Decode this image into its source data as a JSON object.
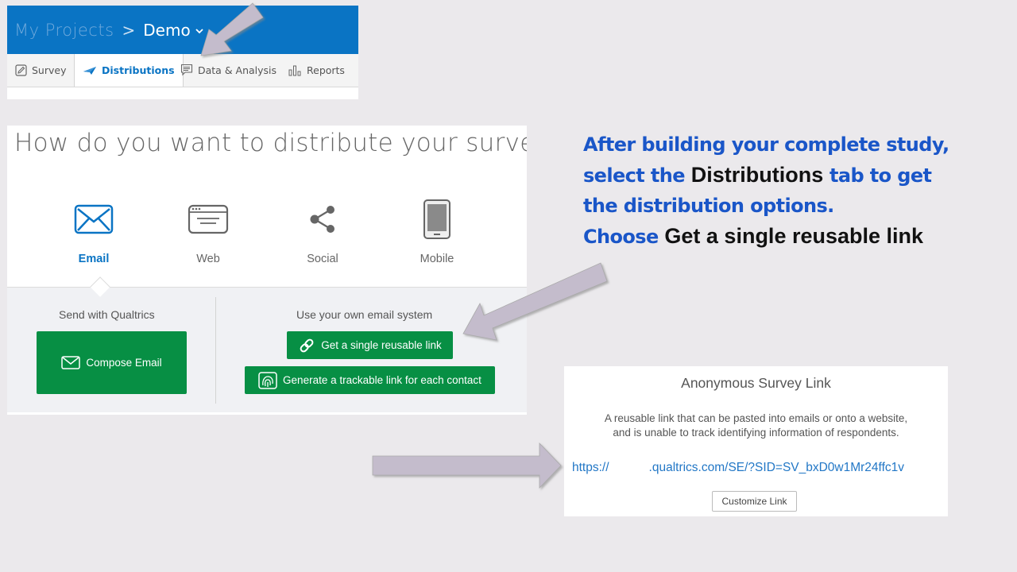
{
  "header": {
    "breadcrumb_projects": "My Projects",
    "breadcrumb_sep": ">",
    "breadcrumb_current": "Demo",
    "caret": "⌄"
  },
  "tabs": [
    {
      "label": "Survey",
      "icon": "pencil-icon"
    },
    {
      "label": "Distributions",
      "icon": "paper-plane-icon",
      "active": true
    },
    {
      "label": "Data & Analysis",
      "icon": "chat-lines-icon"
    },
    {
      "label": "Reports",
      "icon": "bar-chart-icon"
    }
  ],
  "distribute": {
    "title": "How do you want to distribute your survey?",
    "channels": [
      {
        "label": "Email",
        "icon": "envelope-icon",
        "active": true
      },
      {
        "label": "Web",
        "icon": "browser-window-icon"
      },
      {
        "label": "Social",
        "icon": "share-icon"
      },
      {
        "label": "Mobile",
        "icon": "mobile-phone-icon"
      }
    ],
    "send_label": "Send with Qualtrics",
    "compose_button": "Compose Email",
    "own_label": "Use your own email system",
    "reusable_button": "Get a single reusable link",
    "trackable_button": "Generate a trackable link for each contact"
  },
  "instructions": {
    "line1": "After building your complete study,",
    "line2_a": "select the ",
    "line2_b": "Distributions",
    "line2_c": " tab to get",
    "line3": "the distribution options.",
    "line4_a": "Choose ",
    "line4_b": "Get a single reusable link"
  },
  "link_panel": {
    "title": "Anonymous Survey Link",
    "desc_line1": "A reusable link that can be pasted into emails or onto a website,",
    "desc_line2": "and is unable to track identifying information of respondents.",
    "url_prefix": "https://",
    "url_rest": ".qualtrics.com/SE/?SID=SV_bxD0w1Mr24ffc1v",
    "customize_button": "Customize Link"
  },
  "colors": {
    "accent_blue": "#0a74c4",
    "button_green": "#078f44",
    "instruction_blue": "#1a56c8",
    "arrow_fill": "#c4bccc"
  }
}
